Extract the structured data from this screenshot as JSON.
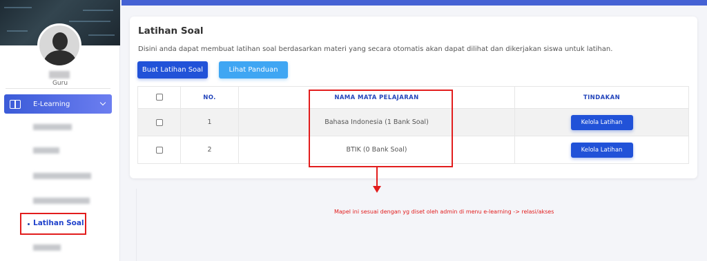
{
  "sidebar": {
    "user_role": "Guru",
    "menu": {
      "elearning_label": "E-Learning",
      "active_item_label": "Latihan Soal"
    }
  },
  "card": {
    "title": "Latihan Soal",
    "description": "Disini anda dapat membuat latihan soal berdasarkan materi yang secara otomatis akan dapat dilihat dan dikerjakan siswa untuk latihan.",
    "buttons": {
      "create": "Buat Latihan Soal",
      "guide": "Lihat Panduan"
    },
    "table": {
      "headers": {
        "no": "NO.",
        "name": "NAMA MATA PELAJARAN",
        "action": "TINDAKAN"
      },
      "rows": [
        {
          "no": "1",
          "name": "Bahasa Indonesia (1 Bank Soal)",
          "action": "Kelola Latihan"
        },
        {
          "no": "2",
          "name": "BTIK (0 Bank Soal)",
          "action": "Kelola Latihan"
        }
      ]
    }
  },
  "annotation": {
    "note": "Mapel ini sesuai dengan yg diset oleh admin di menu e-learning -> relasi/akses",
    "color": "#e21c1c"
  },
  "colors": {
    "primary": "#2152d8",
    "info": "#3fa6f3",
    "topbar": "#4562d4"
  }
}
